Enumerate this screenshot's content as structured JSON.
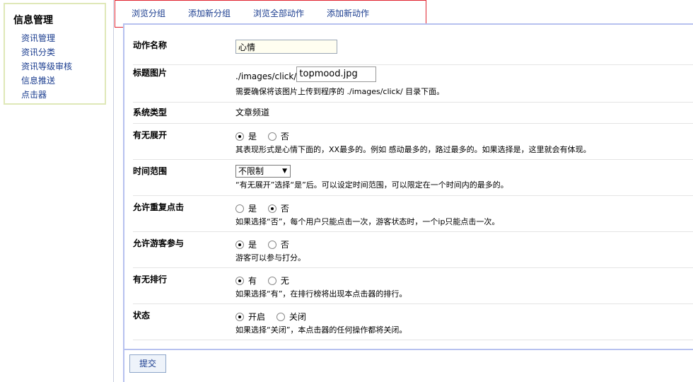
{
  "sidebar": {
    "title": "信息管理",
    "items": [
      {
        "label": "资讯管理"
      },
      {
        "label": "资讯分类"
      },
      {
        "label": "资讯等级审核"
      },
      {
        "label": "信息推送"
      },
      {
        "label": "点击器"
      }
    ]
  },
  "tabs": [
    {
      "label": "浏览分组"
    },
    {
      "label": "添加新分组"
    },
    {
      "label": "浏览全部动作"
    },
    {
      "label": "添加新动作"
    }
  ],
  "form": {
    "action_name": {
      "label": "动作名称",
      "value": "心情"
    },
    "title_image": {
      "label": "标题图片",
      "prefix": "./images/click/",
      "value": "topmood.jpg",
      "note": "需要确保将该图片上传到程序的 ./images/click/ 目录下面。"
    },
    "system_type": {
      "label": "系统类型",
      "value": "文章频道"
    },
    "expand": {
      "label": "有无展开",
      "options": [
        {
          "label": "是",
          "checked": true
        },
        {
          "label": "否",
          "checked": false
        }
      ],
      "note": "其表现形式是心情下面的，XX最多的。例如 感动最多的，路过最多的。如果选择是，这里就会有体现。"
    },
    "time_range": {
      "label": "时间范围",
      "selected": "不限制",
      "note": "“有无展开”选择“是”后。可以设定时间范围，可以限定在一个时间内的最多的。"
    },
    "repeat_click": {
      "label": "允许重复点击",
      "options": [
        {
          "label": "是",
          "checked": false
        },
        {
          "label": "否",
          "checked": true
        }
      ],
      "note": "如果选择“否”，每个用户只能点击一次，游客状态时，一个ip只能点击一次。"
    },
    "guest": {
      "label": "允许游客参与",
      "options": [
        {
          "label": "是",
          "checked": true
        },
        {
          "label": "否",
          "checked": false
        }
      ],
      "note": "游客可以参与打分。"
    },
    "ranking": {
      "label": "有无排行",
      "options": [
        {
          "label": "有",
          "checked": true
        },
        {
          "label": "无",
          "checked": false
        }
      ],
      "note": "如果选择“有”，在排行榜将出现本点击器的排行。"
    },
    "status": {
      "label": "状态",
      "options": [
        {
          "label": "开启",
          "checked": true
        },
        {
          "label": "关闭",
          "checked": false
        }
      ],
      "note": "如果选择“关闭”，本点击器的任何操作都将关闭。"
    }
  },
  "submit_label": "提交",
  "icons": {
    "select_caret": "chevron-down-icon",
    "radio": "radio-icon"
  }
}
